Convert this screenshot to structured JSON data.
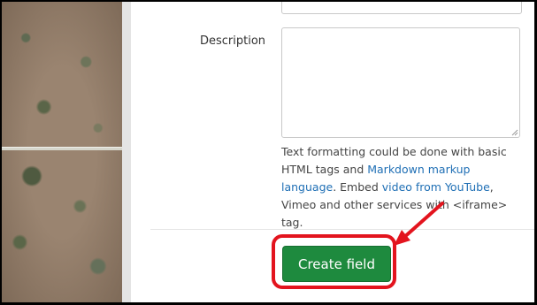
{
  "form": {
    "description_label": "Description",
    "description_value": "",
    "help": {
      "part1": "Text formatting could be done with basic HTML tags and ",
      "link1": "Markdown markup language",
      "part2": ". Embed ",
      "link2": "video from YouTube",
      "part3": ", Vimeo and other services with <iframe> tag."
    },
    "submit_label": "Create field"
  },
  "annotation": {
    "color": "#e3141e"
  },
  "colors": {
    "button": "#1e8a3e",
    "link": "#1f6fb5"
  }
}
